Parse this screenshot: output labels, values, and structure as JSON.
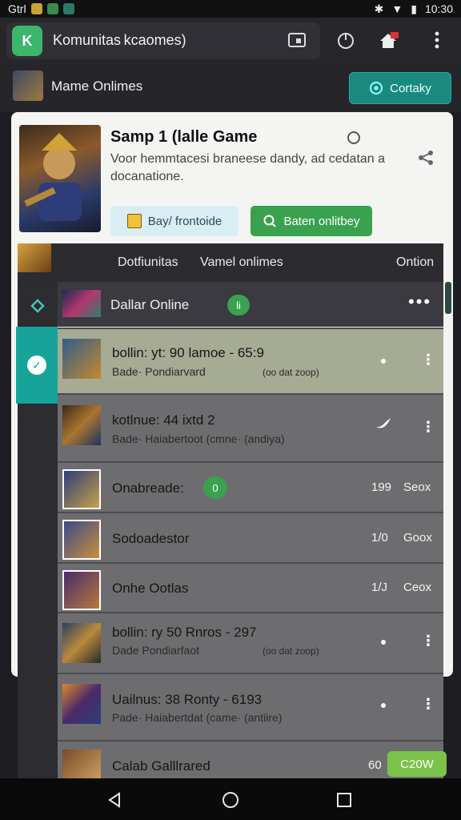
{
  "status_bar": {
    "left_text": "Gtrl",
    "time": "10:30"
  },
  "app_bar": {
    "logo_text": "K",
    "title": "Komunitas kcaomes)"
  },
  "sub_header": {
    "title": "Mame Onlimes",
    "contact_label": "Cortaky"
  },
  "card": {
    "title": "Samp 1 (lalle Game",
    "description": "Voor hemmtacesi braneese dandy, ad cedatan a docanatione.",
    "btn_light_label": "Bay/ frontoide",
    "btn_green_label": "Baten onlitbey"
  },
  "tabs": [
    "Dotfiunitas",
    "Vamel onlimes",
    "Ontion"
  ],
  "list_header": {
    "title": "Dallar Online",
    "badge": "li"
  },
  "rows": [
    {
      "title": "bollin: yt: 90 lamoe - 65:9",
      "sub": "Bade·  Pondiarvard",
      "sub2": "(oo dat zoop)",
      "highlight": true,
      "trailing": "dot-kebab"
    },
    {
      "title": "kotlnue: 44 ixtd        2",
      "sub": "Bade·  Haiabertoot  (cmne· (andiya)",
      "trailing": "bird-kebab"
    },
    {
      "title": "Onabreade:",
      "badge": "0",
      "num": "199",
      "unit": "Seox",
      "trailing": "num"
    },
    {
      "title": "Sodoadestor",
      "num": "1/0",
      "unit": "Goox",
      "trailing": "num"
    },
    {
      "title": "Onhe Ootlas",
      "num": "1/J",
      "unit": "Ceox",
      "trailing": "num"
    },
    {
      "title": "bollin: ry  50  Rnros - 297",
      "sub": "Dade   Pondiarfaot",
      "sub2": "(oo dat zoop)",
      "trailing": "dot-kebab"
    },
    {
      "title": "Uailnus: 38 Ronty - 6193",
      "sub": "Pade·  Haiabertdat  (came· (antiire)",
      "trailing": "dot-kebab"
    },
    {
      "title": "Calab Galllrared",
      "num": "60",
      "pill": "C20W",
      "trailing": "pill"
    }
  ],
  "colors": {
    "accent_teal": "#17a39a",
    "accent_green": "#3aa14f",
    "highlight_row": "#a6ab93"
  }
}
